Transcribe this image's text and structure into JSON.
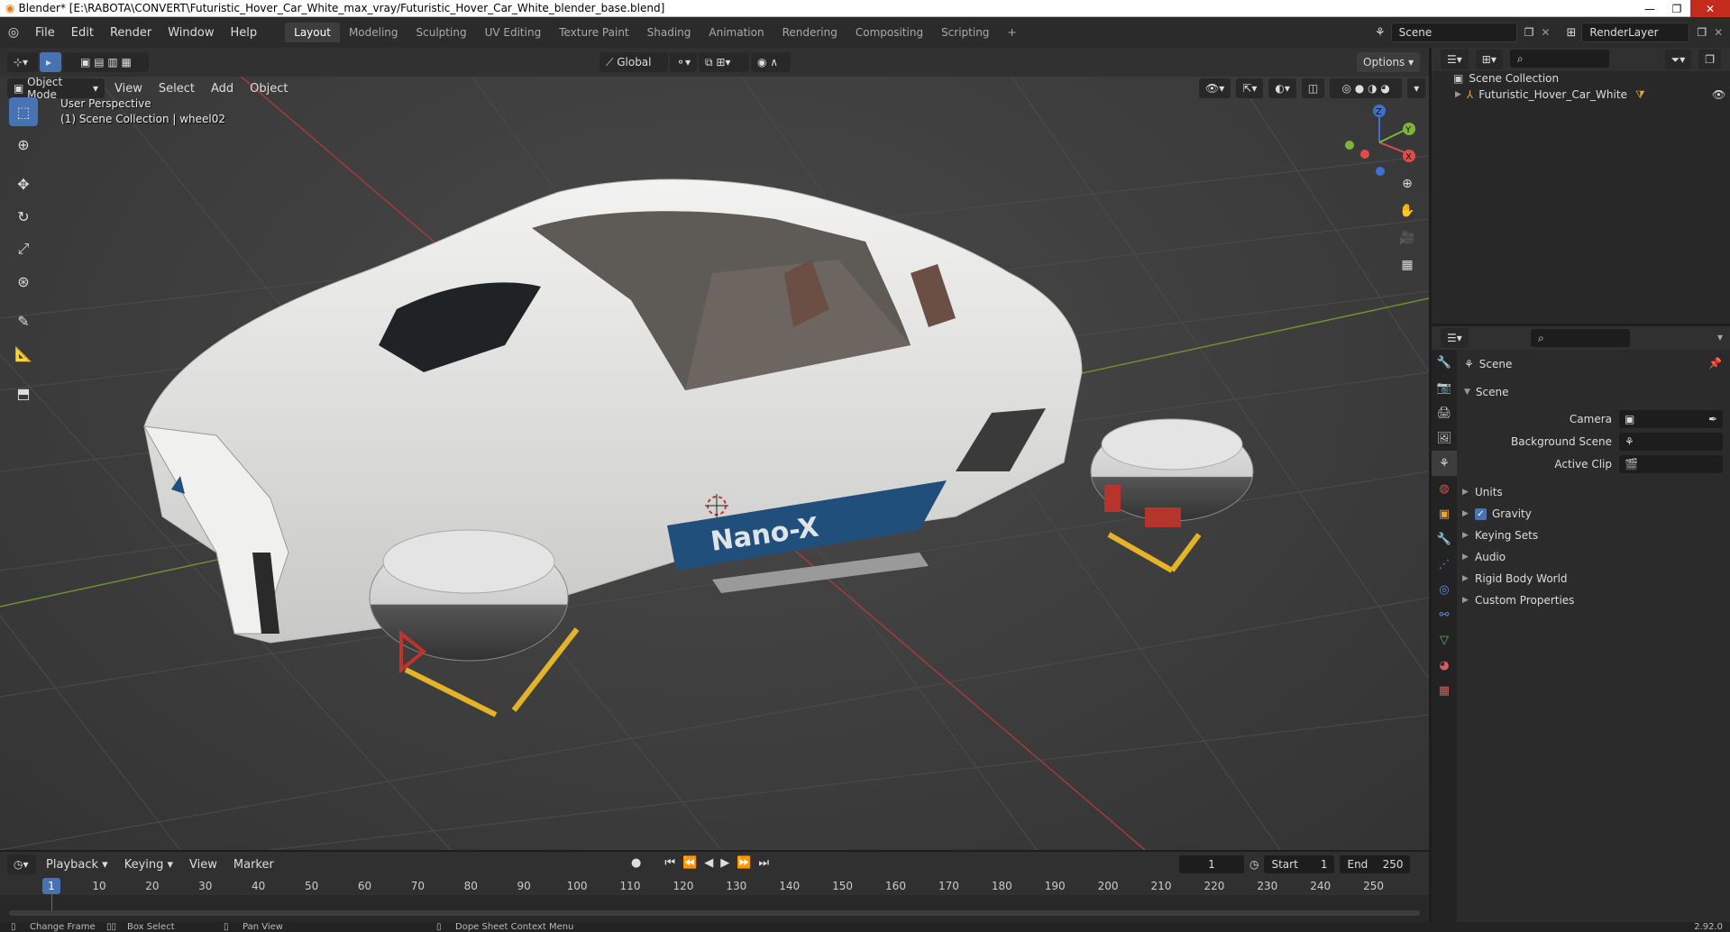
{
  "window": {
    "title": "Blender* [E:\\RABOTA\\CONVERT\\Futuristic_Hover_Car_White_max_vray/Futuristic_Hover_Car_White_blender_base.blend]",
    "min": "—",
    "max": "❐",
    "close": "✕"
  },
  "menu": [
    "File",
    "Edit",
    "Render",
    "Window",
    "Help"
  ],
  "workspaces": [
    "Layout",
    "Modeling",
    "Sculpting",
    "UV Editing",
    "Texture Paint",
    "Shading",
    "Animation",
    "Rendering",
    "Compositing",
    "Scripting"
  ],
  "workspace_add": "+",
  "scene_name": "Scene",
  "view_layer": "RenderLayer",
  "viewport": {
    "mode": "Object Mode",
    "menus": [
      "View",
      "Select",
      "Add",
      "Object"
    ],
    "transform_orientation": "Global",
    "options": "Options",
    "perspective": "User Perspective",
    "collection_info": "(1) Scene Collection | wheel02",
    "gizmo": {
      "x": "X",
      "y": "Y",
      "z": "Z"
    },
    "car_brand_text": "Nano-X",
    "colors": {
      "background": "#3c3c3c",
      "grid": "#4a4a4a",
      "x_axis": "#b03a3a",
      "y_axis": "#7a9a3a",
      "car_body": "#e8e8e6",
      "stripe": "#1f4f7a",
      "leg": "#e3b428"
    }
  },
  "outliner": {
    "root": "Scene Collection",
    "items": [
      {
        "label": "Futuristic_Hover_Car_White"
      }
    ]
  },
  "properties": {
    "context": "Scene",
    "panel_title": "Scene",
    "fields": [
      {
        "label": "Camera",
        "value": ""
      },
      {
        "label": "Background Scene",
        "value": ""
      },
      {
        "label": "Active Clip",
        "value": ""
      }
    ],
    "subpanels": [
      {
        "label": "Units",
        "checkbox": false
      },
      {
        "label": "Gravity",
        "checkbox": true
      },
      {
        "label": "Keying Sets",
        "checkbox": false
      },
      {
        "label": "Audio",
        "checkbox": false
      },
      {
        "label": "Rigid Body World",
        "checkbox": false
      },
      {
        "label": "Custom Properties",
        "checkbox": false
      }
    ]
  },
  "timeline": {
    "menus": [
      "Playback",
      "Keying",
      "View",
      "Marker"
    ],
    "current_frame": "1",
    "start_label": "Start",
    "start": "1",
    "end_label": "End",
    "end": "250",
    "ruler": [
      "1",
      "10",
      "20",
      "30",
      "40",
      "50",
      "60",
      "70",
      "80",
      "90",
      "100",
      "110",
      "120",
      "130",
      "140",
      "150",
      "160",
      "170",
      "180",
      "190",
      "200",
      "210",
      "220",
      "230",
      "240",
      "250"
    ]
  },
  "statusbar": {
    "items": [
      "Change Frame",
      "Box Select",
      "Pan View",
      "Dope Sheet Context Menu"
    ],
    "version": "2.92.0"
  }
}
